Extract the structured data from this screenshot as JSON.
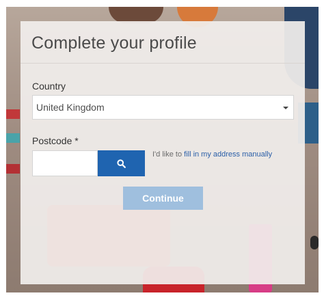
{
  "profile_form": {
    "title": "Complete your profile",
    "country": {
      "label": "Country",
      "selected": "United Kingdom"
    },
    "postcode": {
      "label": "Postcode *",
      "value": "",
      "search_icon": "search-icon"
    },
    "manual_address": {
      "prefix": "I'd like to ",
      "link_text": "fill in my address manually"
    },
    "continue_label": "Continue"
  },
  "colors": {
    "search_button": "#1f64b0",
    "continue_button_disabled": "#9fbfde",
    "link": "#2b5fa8"
  }
}
